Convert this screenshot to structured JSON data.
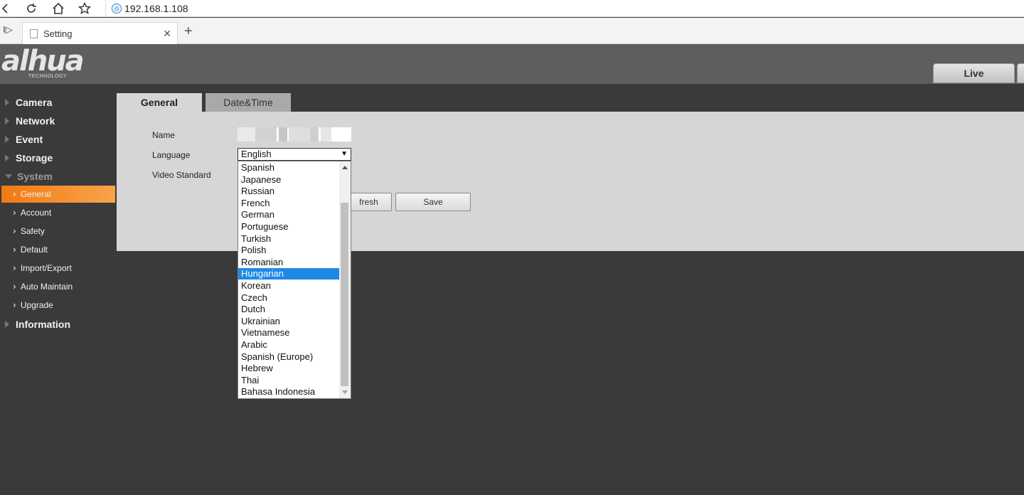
{
  "browser": {
    "url": "192.168.1.108",
    "tab_title": "Setting"
  },
  "header": {
    "logo_text": "alhua",
    "logo_sub": "TECHNOLOGY",
    "live_label": "Live"
  },
  "sidebar": {
    "sections": [
      {
        "label": "Camera"
      },
      {
        "label": "Network"
      },
      {
        "label": "Event"
      },
      {
        "label": "Storage"
      },
      {
        "label": "System"
      },
      {
        "label": "Information"
      }
    ],
    "system_items": [
      {
        "label": "General",
        "active": true
      },
      {
        "label": "Account"
      },
      {
        "label": "Safety"
      },
      {
        "label": "Default"
      },
      {
        "label": "Import/Export"
      },
      {
        "label": "Auto Maintain"
      },
      {
        "label": "Upgrade"
      }
    ]
  },
  "content": {
    "tabs": [
      {
        "label": "General"
      },
      {
        "label": "Date&Time"
      }
    ],
    "form": {
      "name_label": "Name",
      "language_label": "Language",
      "video_standard_label": "Video Standard",
      "language_value": "English"
    },
    "buttons": {
      "refresh": "fresh",
      "save": "Save"
    },
    "language_options": [
      "Spanish",
      "Japanese",
      "Russian",
      "French",
      "German",
      "Portuguese",
      "Turkish",
      "Polish",
      "Romanian",
      "Hungarian",
      "Korean",
      "Czech",
      "Dutch",
      "Ukrainian",
      "Vietnamese",
      "Arabic",
      "Spanish (Europe)",
      "Hebrew",
      "Thai",
      "Bahasa Indonesia"
    ],
    "highlighted_option": "Hungarian"
  },
  "colors": {
    "accent": "#f07a12",
    "selection": "#1e88e5"
  }
}
